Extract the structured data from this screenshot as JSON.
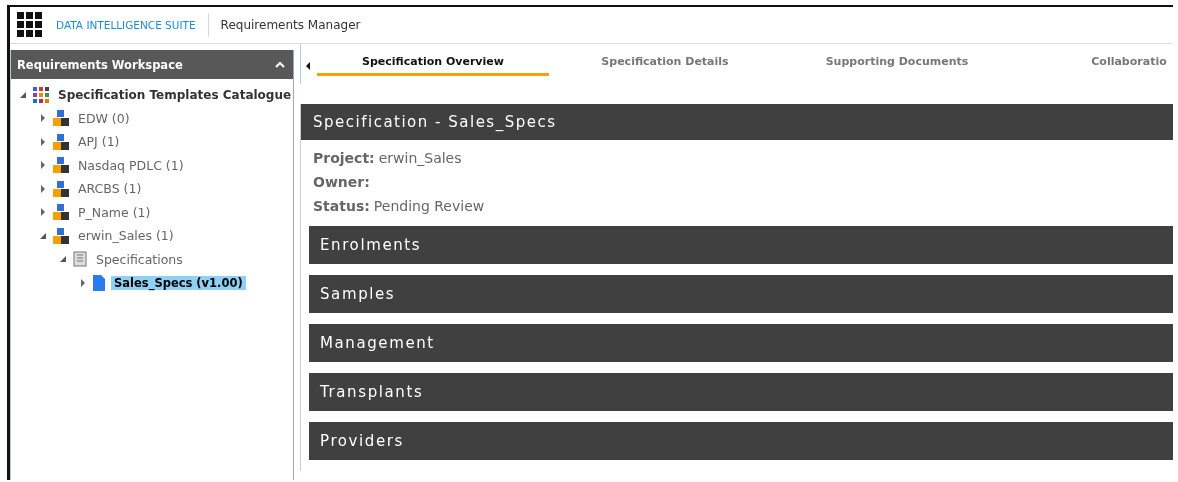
{
  "header": {
    "brand": "DATA INTELLIGENCE SUITE",
    "module": "Requirements Manager"
  },
  "sidebar": {
    "title": "Requirements Workspace",
    "tree": [
      {
        "label": "Specification Templates Catalogue",
        "kind": "catalogue",
        "expanded": true,
        "selected": false,
        "children": [
          {
            "label": "EDW (0)",
            "kind": "project",
            "expanded": false,
            "selected": false
          },
          {
            "label": "APJ (1)",
            "kind": "project",
            "expanded": false,
            "selected": false
          },
          {
            "label": "Nasdaq PDLC (1)",
            "kind": "project",
            "expanded": false,
            "selected": false
          },
          {
            "label": "ARCBS (1)",
            "kind": "project",
            "expanded": false,
            "selected": false
          },
          {
            "label": "P_Name (1)",
            "kind": "project",
            "expanded": false,
            "selected": false
          },
          {
            "label": "erwin_Sales (1)",
            "kind": "project",
            "expanded": true,
            "selected": false,
            "children": [
              {
                "label": "Specifications",
                "kind": "folder",
                "expanded": true,
                "selected": false,
                "children": [
                  {
                    "label": "Sales_Specs (v1.00)",
                    "kind": "document",
                    "expanded": false,
                    "selected": true
                  }
                ]
              }
            ]
          }
        ]
      }
    ]
  },
  "tabs": [
    {
      "label": "Specification Overview",
      "selected": true
    },
    {
      "label": "Specification Details",
      "selected": false
    },
    {
      "label": "Supporting Documents",
      "selected": false
    },
    {
      "label": "Collaboratio",
      "selected": false
    }
  ],
  "specification": {
    "title": "Specification - Sales_Specs",
    "fields": [
      {
        "label": "Project:",
        "value": "erwin_Sales"
      },
      {
        "label": "Owner:"
      },
      {
        "label": "Status:",
        "value": "Pending Review"
      }
    ]
  },
  "sections": [
    "Enrolments",
    "Samples",
    "Management",
    "Transplants",
    "Providers"
  ]
}
